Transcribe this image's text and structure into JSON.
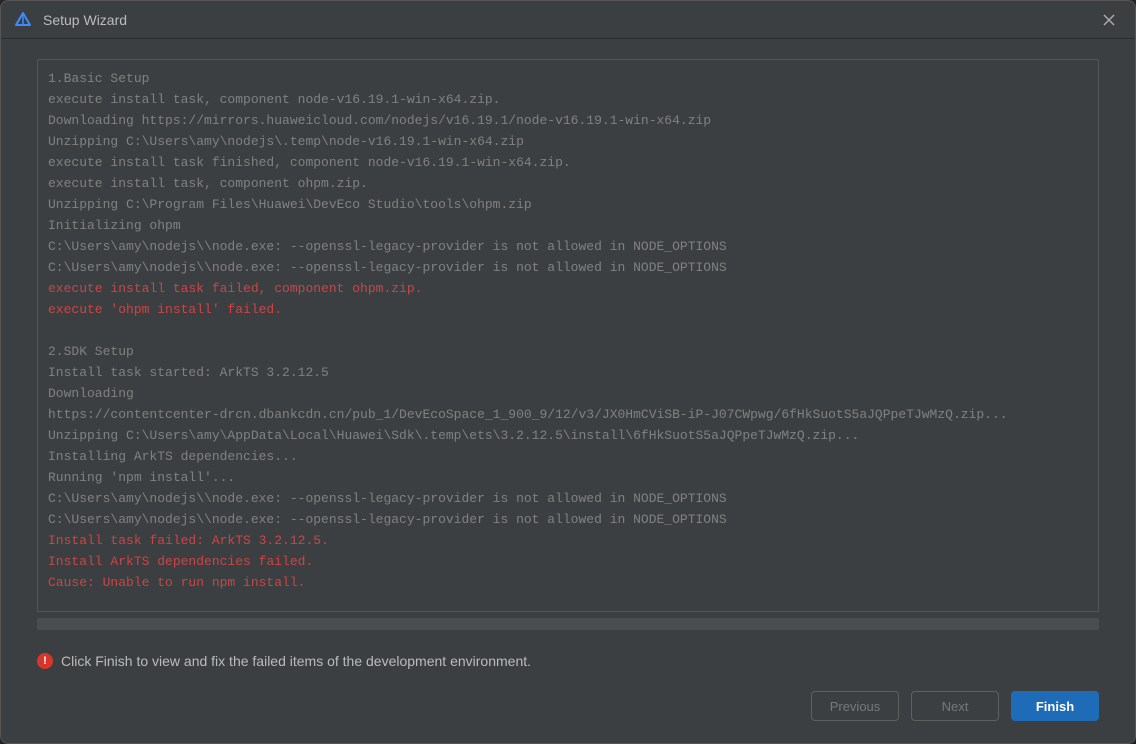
{
  "window": {
    "title": "Setup Wizard"
  },
  "log": {
    "lines": [
      {
        "text": "1.Basic Setup",
        "error": false
      },
      {
        "text": "execute install task, component node-v16.19.1-win-x64.zip.",
        "error": false
      },
      {
        "text": "Downloading https://mirrors.huaweicloud.com/nodejs/v16.19.1/node-v16.19.1-win-x64.zip",
        "error": false
      },
      {
        "text": "Unzipping C:\\Users\\amy\\nodejs\\.temp\\node-v16.19.1-win-x64.zip",
        "error": false
      },
      {
        "text": "execute install task finished, component node-v16.19.1-win-x64.zip.",
        "error": false
      },
      {
        "text": "execute install task, component ohpm.zip.",
        "error": false
      },
      {
        "text": "Unzipping C:\\Program Files\\Huawei\\DevEco Studio\\tools\\ohpm.zip",
        "error": false
      },
      {
        "text": "Initializing ohpm",
        "error": false
      },
      {
        "text": "C:\\Users\\amy\\nodejs\\\\node.exe: --openssl-legacy-provider is not allowed in NODE_OPTIONS",
        "error": false
      },
      {
        "text": "C:\\Users\\amy\\nodejs\\\\node.exe: --openssl-legacy-provider is not allowed in NODE_OPTIONS",
        "error": false
      },
      {
        "text": "execute install task failed, component ohpm.zip.",
        "error": true
      },
      {
        "text": "execute 'ohpm install' failed.",
        "error": true
      },
      {
        "text": "",
        "error": false
      },
      {
        "text": "2.SDK Setup",
        "error": false
      },
      {
        "text": "Install task started: ArkTS 3.2.12.5",
        "error": false
      },
      {
        "text": "Downloading",
        "error": false
      },
      {
        "text": "https://contentcenter-drcn.dbankcdn.cn/pub_1/DevEcoSpace_1_900_9/12/v3/JX0HmCViSB-iP-J07CWpwg/6fHkSuotS5aJQPpeTJwMzQ.zip...",
        "error": false
      },
      {
        "text": "Unzipping C:\\Users\\amy\\AppData\\Local\\Huawei\\Sdk\\.temp\\ets\\3.2.12.5\\install\\6fHkSuotS5aJQPpeTJwMzQ.zip...",
        "error": false
      },
      {
        "text": "Installing ArkTS dependencies...",
        "error": false
      },
      {
        "text": "Running 'npm install'...",
        "error": false
      },
      {
        "text": "C:\\Users\\amy\\nodejs\\\\node.exe: --openssl-legacy-provider is not allowed in NODE_OPTIONS",
        "error": false
      },
      {
        "text": "C:\\Users\\amy\\nodejs\\\\node.exe: --openssl-legacy-provider is not allowed in NODE_OPTIONS",
        "error": false
      },
      {
        "text": "Install task failed: ArkTS 3.2.12.5.",
        "error": true
      },
      {
        "text": "Install ArkTS dependencies failed.",
        "error": true
      },
      {
        "text": "Cause: Unable to run npm install.",
        "error": true
      }
    ]
  },
  "status": {
    "message": "Click Finish to view and fix the failed items of the development environment."
  },
  "buttons": {
    "previous": "Previous",
    "next": "Next",
    "finish": "Finish"
  }
}
